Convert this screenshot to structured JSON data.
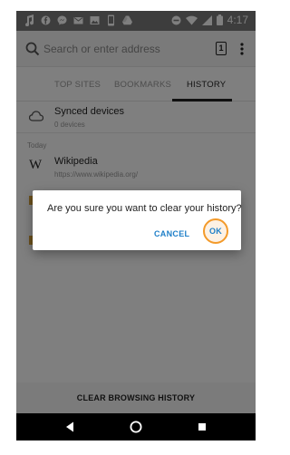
{
  "status_bar": {
    "time": "4:17"
  },
  "url_bar": {
    "placeholder": "Search or enter address",
    "tab_count": "1"
  },
  "panel_tabs": [
    {
      "label": "TOP SITES"
    },
    {
      "label": "BOOKMARKS"
    },
    {
      "label": "HISTORY"
    }
  ],
  "synced": {
    "title": "Synced devices",
    "subtitle": "0 devices"
  },
  "section": {
    "today_label": "Today"
  },
  "history_items": [
    {
      "title": "Wikipedia",
      "url": "https://www.wikipedia.org/",
      "icon_letter": "W"
    }
  ],
  "bottom_action": {
    "label": "CLEAR BROWSING HISTORY"
  },
  "dialog": {
    "message": "Are you sure you want to clear your history?",
    "cancel_label": "CANCEL",
    "ok_label": "OK"
  },
  "colors": {
    "accent": "#1e7fc8",
    "highlight": "#f39a2a",
    "status_bar": "#7a7a7a"
  },
  "icons": [
    "music-icon",
    "facebook-icon",
    "messenger-icon",
    "mail-icon",
    "image-icon",
    "phone-icon",
    "drive-icon",
    "dnd-icon",
    "wifi-icon",
    "signal-icon",
    "battery-icon",
    "search-icon",
    "tabs-counter-icon",
    "overflow-menu-icon",
    "cloud-icon",
    "wikipedia-icon",
    "back-icon",
    "home-icon",
    "recents-icon"
  ]
}
